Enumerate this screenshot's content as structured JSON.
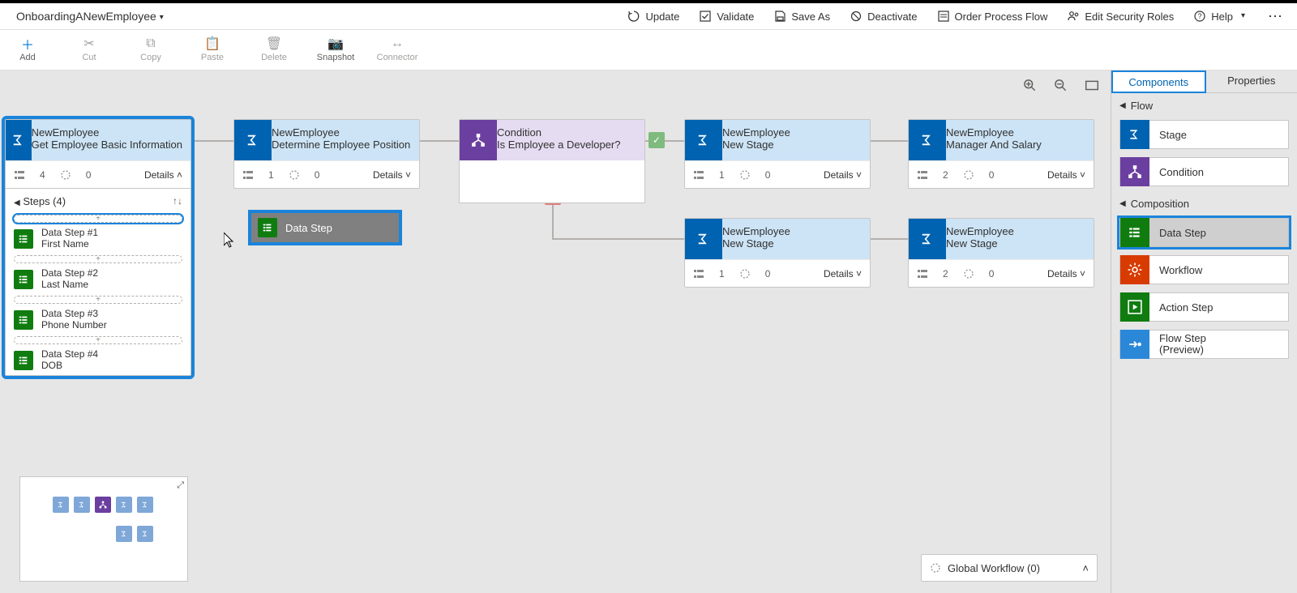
{
  "process_name": "OnboardingANewEmployee",
  "command_bar": {
    "update": "Update",
    "validate": "Validate",
    "save_as": "Save As",
    "deactivate": "Deactivate",
    "order": "Order Process Flow",
    "security": "Edit Security Roles",
    "help": "Help"
  },
  "toolbar": {
    "add": "Add",
    "cut": "Cut",
    "copy": "Copy",
    "paste": "Paste",
    "delete": "Delete",
    "snapshot": "Snapshot",
    "connector": "Connector"
  },
  "details_label": "Details",
  "steps_label": "Steps (4)",
  "entity": "NewEmployee",
  "stages": {
    "s1": {
      "title": "Get Employee Basic Information",
      "steps": 4,
      "tasks": 0
    },
    "s2": {
      "title": "Determine Employee Position",
      "steps": 1,
      "tasks": 0
    },
    "cond": {
      "title1": "Condition",
      "title2": "Is Employee a Developer?"
    },
    "s3": {
      "title": "New Stage",
      "steps": 1,
      "tasks": 0
    },
    "s4": {
      "title": "Manager And Salary",
      "steps": 2,
      "tasks": 0
    },
    "s5": {
      "title": "New Stage",
      "steps": 1,
      "tasks": 0
    },
    "s6": {
      "title": "New Stage",
      "steps": 2,
      "tasks": 0
    }
  },
  "data_steps": {
    "d1": {
      "name": "Data Step #1",
      "field": "First Name"
    },
    "d2": {
      "name": "Data Step #2",
      "field": "Last Name"
    },
    "d3": {
      "name": "Data Step #3",
      "field": "Phone Number"
    },
    "d4": {
      "name": "Data Step #4",
      "field": "DOB"
    }
  },
  "drag_label": "Data Step",
  "panel": {
    "tab_components": "Components",
    "tab_properties": "Properties",
    "group_flow": "Flow",
    "group_composition": "Composition",
    "stage": "Stage",
    "condition": "Condition",
    "data_step": "Data Step",
    "workflow": "Workflow",
    "action_step": "Action Step",
    "flow_step_l1": "Flow Step",
    "flow_step_l2": "(Preview)"
  },
  "global_workflow": "Global Workflow (0)"
}
